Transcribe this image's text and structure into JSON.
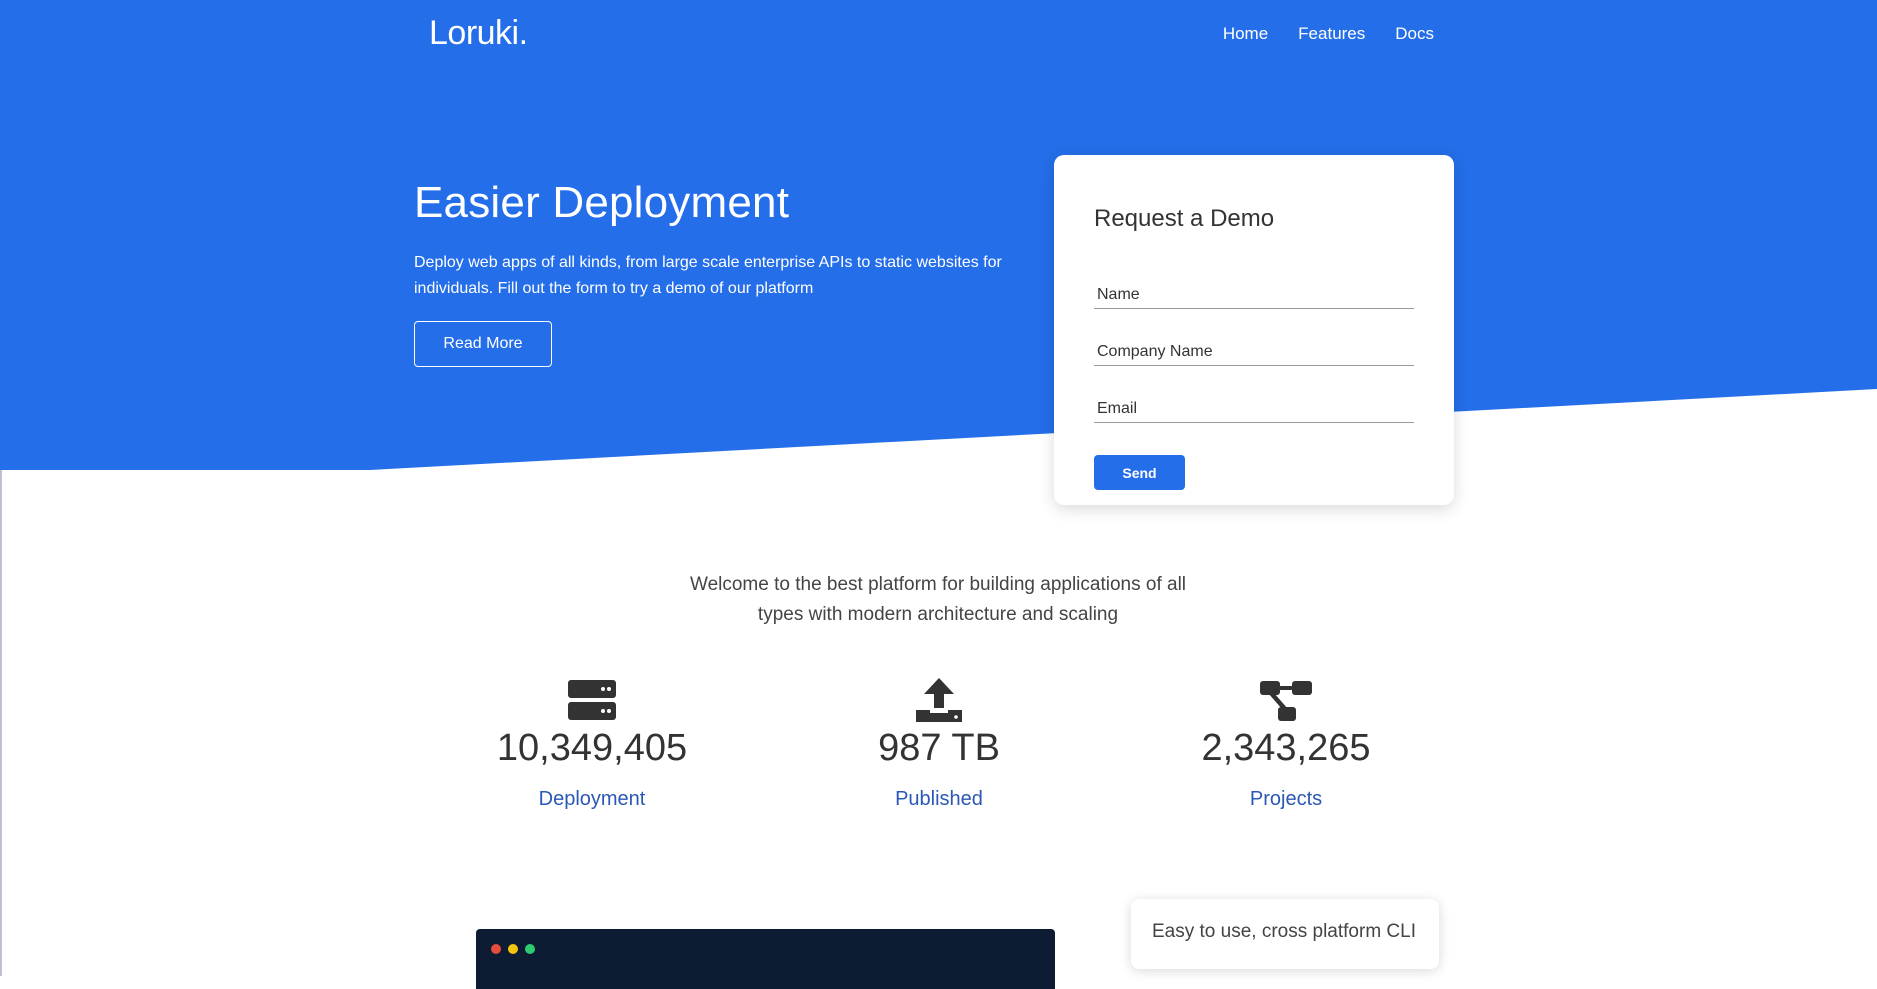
{
  "brand": "Loruki.",
  "nav": [
    "Home",
    "Features",
    "Docs"
  ],
  "hero": {
    "title": "Easier Deployment",
    "subtitle": "Deploy web apps of all kinds, from large scale enterprise APIs to static websites for individuals. Fill out the form to try a demo of our platform",
    "button": "Read More"
  },
  "demo_form": {
    "title": "Request a Demo",
    "fields": [
      {
        "placeholder": "Name",
        "value": ""
      },
      {
        "placeholder": "Company Name",
        "value": ""
      },
      {
        "placeholder": "Email",
        "value": ""
      }
    ],
    "submit": "Send"
  },
  "welcome": "Welcome to the best platform for building applications of all types with modern architecture and scaling",
  "stats": [
    {
      "icon": "server-icon",
      "value": "10,349,405",
      "label": "Deployment"
    },
    {
      "icon": "upload-icon",
      "value": "987 TB",
      "label": "Published"
    },
    {
      "icon": "project-diagram-icon",
      "value": "2,343,265",
      "label": "Projects"
    }
  ],
  "cli_card": "Easy to use, cross platform CLI",
  "colors": {
    "primary": "#246ee9",
    "link": "#2b57b6",
    "terminal_bg": "#0d1b33"
  }
}
